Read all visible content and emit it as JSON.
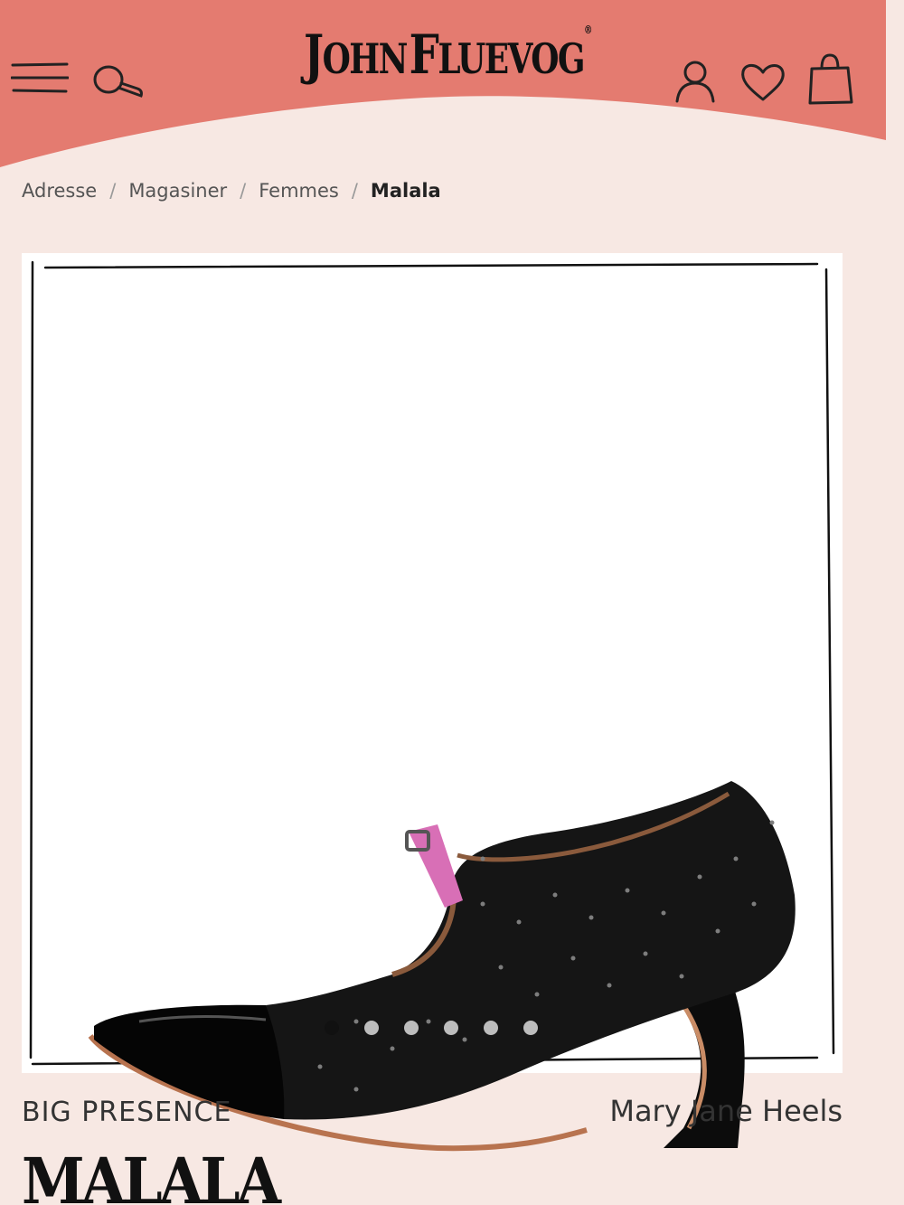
{
  "colors": {
    "header_bg": "#e47b70",
    "page_bg": "#f7e8e3",
    "text": "#222222",
    "dot_active": "#111111",
    "dot_inactive": "#bdbdbd"
  },
  "header": {
    "logo_word1_initial": "J",
    "logo_word1_rest": "OHN",
    "logo_word2_initial": "F",
    "logo_word2_rest": "LUEVOG",
    "logo_registered": "®",
    "icons": [
      "menu-icon",
      "search-icon",
      "account-icon",
      "wishlist-icon",
      "cart-icon"
    ]
  },
  "breadcrumb": {
    "items": [
      "Adresse",
      "Magasiner",
      "Femmes"
    ],
    "separator": "/",
    "current": "Malala"
  },
  "gallery": {
    "slide_count": 6,
    "active_index": 0
  },
  "product": {
    "collection": "BIG PRESENCE",
    "category": "Mary Jane Heels",
    "name": "MALALA"
  }
}
